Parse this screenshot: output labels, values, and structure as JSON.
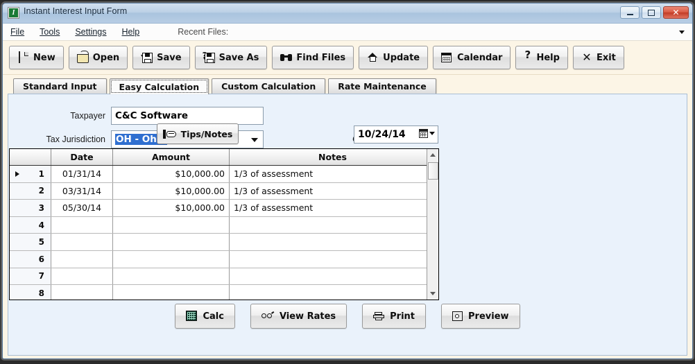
{
  "window": {
    "title": "Instant Interest Input Form",
    "app_icon": "app-logo-icon",
    "icon_letter": "I",
    "controls": {
      "minimize": "minimize-button",
      "maximize": "maximize-button",
      "close": "✕"
    }
  },
  "menubar": {
    "items": [
      {
        "label": "File",
        "accel": "F"
      },
      {
        "label": "Tools",
        "accel": "T"
      },
      {
        "label": "Settings",
        "accel": "S"
      },
      {
        "label": "Help",
        "accel": "H"
      }
    ],
    "recent_files_label": "Recent Files:",
    "recent_files_value": ""
  },
  "toolbar": {
    "buttons": [
      {
        "label": "New",
        "icon": "new-page-icon"
      },
      {
        "label": "Open",
        "icon": "open-folder-icon"
      },
      {
        "label": "Save",
        "icon": "save-disk-icon"
      },
      {
        "label": "Save As",
        "icon": "save-as-disk-icon"
      },
      {
        "label": "Find Files",
        "icon": "binoculars-icon"
      },
      {
        "label": "Update",
        "icon": "house-update-icon"
      },
      {
        "label": "Calendar",
        "icon": "calendar-icon"
      },
      {
        "label": "Help",
        "icon": "question-mark-icon"
      },
      {
        "label": "Exit",
        "icon": "x-exit-icon"
      }
    ]
  },
  "tabs": [
    {
      "label": "Standard Input",
      "active": false
    },
    {
      "label": "Easy Calculation",
      "active": true
    },
    {
      "label": "Custom Calculation",
      "active": false
    },
    {
      "label": "Rate Maintenance",
      "active": false
    }
  ],
  "form": {
    "taxpayer_label": "Taxpayer",
    "taxpayer_value": "C&C Software",
    "jurisdiction_label": "Tax Jurisdiction",
    "jurisdiction_value": "OH  - Ohio",
    "jurisdiction_selected": true,
    "tips_button": "Tips/Notes",
    "tips_icon": "pointing-hand-icon",
    "calc_thru_label": "Calc Thru Date",
    "calc_thru_value": "10/24/14",
    "date_picker_icon": "calendar-picker-icon"
  },
  "grid": {
    "columns": [
      "",
      "Date",
      "Amount",
      "Notes"
    ],
    "current_row": 1,
    "rows": [
      {
        "num": "1",
        "date": "01/31/14",
        "amount": "$10,000.00",
        "notes": "1/3 of assessment"
      },
      {
        "num": "2",
        "date": "03/31/14",
        "amount": "$10,000.00",
        "notes": "1/3 of assessment"
      },
      {
        "num": "3",
        "date": "05/30/14",
        "amount": "$10,000.00",
        "notes": "1/3 of assessment"
      },
      {
        "num": "4",
        "date": "",
        "amount": "",
        "notes": ""
      },
      {
        "num": "5",
        "date": "",
        "amount": "",
        "notes": ""
      },
      {
        "num": "6",
        "date": "",
        "amount": "",
        "notes": ""
      },
      {
        "num": "7",
        "date": "",
        "amount": "",
        "notes": ""
      },
      {
        "num": "8",
        "date": "",
        "amount": "",
        "notes": ""
      },
      {
        "num": "",
        "date": "",
        "amount": "",
        "notes": ""
      }
    ]
  },
  "actions": [
    {
      "label": "Calc",
      "icon": "calculator-icon"
    },
    {
      "label": "View Rates",
      "icon": "glasses-icon"
    },
    {
      "label": "Print",
      "icon": "printer-icon"
    },
    {
      "label": "Preview",
      "icon": "print-preview-icon"
    }
  ],
  "colors": {
    "titlebar": "#b0c8e0",
    "toolbar_bg": "#fcf5e6",
    "panel_bg": "#eaf2fb",
    "selection_blue": "#2f6fd0",
    "close_red": "#c23b26"
  }
}
